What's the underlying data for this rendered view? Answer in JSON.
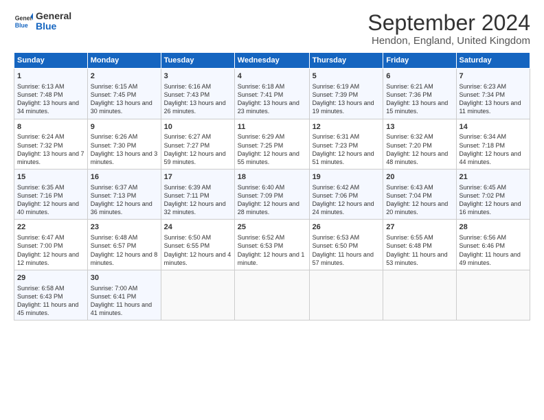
{
  "logo": {
    "general": "General",
    "blue": "Blue"
  },
  "title": "September 2024",
  "location": "Hendon, England, United Kingdom",
  "days_of_week": [
    "Sunday",
    "Monday",
    "Tuesday",
    "Wednesday",
    "Thursday",
    "Friday",
    "Saturday"
  ],
  "weeks": [
    [
      {
        "day": "1",
        "sunrise": "Sunrise: 6:13 AM",
        "sunset": "Sunset: 7:48 PM",
        "daylight": "Daylight: 13 hours and 34 minutes."
      },
      {
        "day": "2",
        "sunrise": "Sunrise: 6:15 AM",
        "sunset": "Sunset: 7:45 PM",
        "daylight": "Daylight: 13 hours and 30 minutes."
      },
      {
        "day": "3",
        "sunrise": "Sunrise: 6:16 AM",
        "sunset": "Sunset: 7:43 PM",
        "daylight": "Daylight: 13 hours and 26 minutes."
      },
      {
        "day": "4",
        "sunrise": "Sunrise: 6:18 AM",
        "sunset": "Sunset: 7:41 PM",
        "daylight": "Daylight: 13 hours and 23 minutes."
      },
      {
        "day": "5",
        "sunrise": "Sunrise: 6:19 AM",
        "sunset": "Sunset: 7:39 PM",
        "daylight": "Daylight: 13 hours and 19 minutes."
      },
      {
        "day": "6",
        "sunrise": "Sunrise: 6:21 AM",
        "sunset": "Sunset: 7:36 PM",
        "daylight": "Daylight: 13 hours and 15 minutes."
      },
      {
        "day": "7",
        "sunrise": "Sunrise: 6:23 AM",
        "sunset": "Sunset: 7:34 PM",
        "daylight": "Daylight: 13 hours and 11 minutes."
      }
    ],
    [
      {
        "day": "8",
        "sunrise": "Sunrise: 6:24 AM",
        "sunset": "Sunset: 7:32 PM",
        "daylight": "Daylight: 13 hours and 7 minutes."
      },
      {
        "day": "9",
        "sunrise": "Sunrise: 6:26 AM",
        "sunset": "Sunset: 7:30 PM",
        "daylight": "Daylight: 13 hours and 3 minutes."
      },
      {
        "day": "10",
        "sunrise": "Sunrise: 6:27 AM",
        "sunset": "Sunset: 7:27 PM",
        "daylight": "Daylight: 12 hours and 59 minutes."
      },
      {
        "day": "11",
        "sunrise": "Sunrise: 6:29 AM",
        "sunset": "Sunset: 7:25 PM",
        "daylight": "Daylight: 12 hours and 55 minutes."
      },
      {
        "day": "12",
        "sunrise": "Sunrise: 6:31 AM",
        "sunset": "Sunset: 7:23 PM",
        "daylight": "Daylight: 12 hours and 51 minutes."
      },
      {
        "day": "13",
        "sunrise": "Sunrise: 6:32 AM",
        "sunset": "Sunset: 7:20 PM",
        "daylight": "Daylight: 12 hours and 48 minutes."
      },
      {
        "day": "14",
        "sunrise": "Sunrise: 6:34 AM",
        "sunset": "Sunset: 7:18 PM",
        "daylight": "Daylight: 12 hours and 44 minutes."
      }
    ],
    [
      {
        "day": "15",
        "sunrise": "Sunrise: 6:35 AM",
        "sunset": "Sunset: 7:16 PM",
        "daylight": "Daylight: 12 hours and 40 minutes."
      },
      {
        "day": "16",
        "sunrise": "Sunrise: 6:37 AM",
        "sunset": "Sunset: 7:13 PM",
        "daylight": "Daylight: 12 hours and 36 minutes."
      },
      {
        "day": "17",
        "sunrise": "Sunrise: 6:39 AM",
        "sunset": "Sunset: 7:11 PM",
        "daylight": "Daylight: 12 hours and 32 minutes."
      },
      {
        "day": "18",
        "sunrise": "Sunrise: 6:40 AM",
        "sunset": "Sunset: 7:09 PM",
        "daylight": "Daylight: 12 hours and 28 minutes."
      },
      {
        "day": "19",
        "sunrise": "Sunrise: 6:42 AM",
        "sunset": "Sunset: 7:06 PM",
        "daylight": "Daylight: 12 hours and 24 minutes."
      },
      {
        "day": "20",
        "sunrise": "Sunrise: 6:43 AM",
        "sunset": "Sunset: 7:04 PM",
        "daylight": "Daylight: 12 hours and 20 minutes."
      },
      {
        "day": "21",
        "sunrise": "Sunrise: 6:45 AM",
        "sunset": "Sunset: 7:02 PM",
        "daylight": "Daylight: 12 hours and 16 minutes."
      }
    ],
    [
      {
        "day": "22",
        "sunrise": "Sunrise: 6:47 AM",
        "sunset": "Sunset: 7:00 PM",
        "daylight": "Daylight: 12 hours and 12 minutes."
      },
      {
        "day": "23",
        "sunrise": "Sunrise: 6:48 AM",
        "sunset": "Sunset: 6:57 PM",
        "daylight": "Daylight: 12 hours and 8 minutes."
      },
      {
        "day": "24",
        "sunrise": "Sunrise: 6:50 AM",
        "sunset": "Sunset: 6:55 PM",
        "daylight": "Daylight: 12 hours and 4 minutes."
      },
      {
        "day": "25",
        "sunrise": "Sunrise: 6:52 AM",
        "sunset": "Sunset: 6:53 PM",
        "daylight": "Daylight: 12 hours and 1 minute."
      },
      {
        "day": "26",
        "sunrise": "Sunrise: 6:53 AM",
        "sunset": "Sunset: 6:50 PM",
        "daylight": "Daylight: 11 hours and 57 minutes."
      },
      {
        "day": "27",
        "sunrise": "Sunrise: 6:55 AM",
        "sunset": "Sunset: 6:48 PM",
        "daylight": "Daylight: 11 hours and 53 minutes."
      },
      {
        "day": "28",
        "sunrise": "Sunrise: 6:56 AM",
        "sunset": "Sunset: 6:46 PM",
        "daylight": "Daylight: 11 hours and 49 minutes."
      }
    ],
    [
      {
        "day": "29",
        "sunrise": "Sunrise: 6:58 AM",
        "sunset": "Sunset: 6:43 PM",
        "daylight": "Daylight: 11 hours and 45 minutes."
      },
      {
        "day": "30",
        "sunrise": "Sunrise: 7:00 AM",
        "sunset": "Sunset: 6:41 PM",
        "daylight": "Daylight: 11 hours and 41 minutes."
      },
      null,
      null,
      null,
      null,
      null
    ]
  ]
}
